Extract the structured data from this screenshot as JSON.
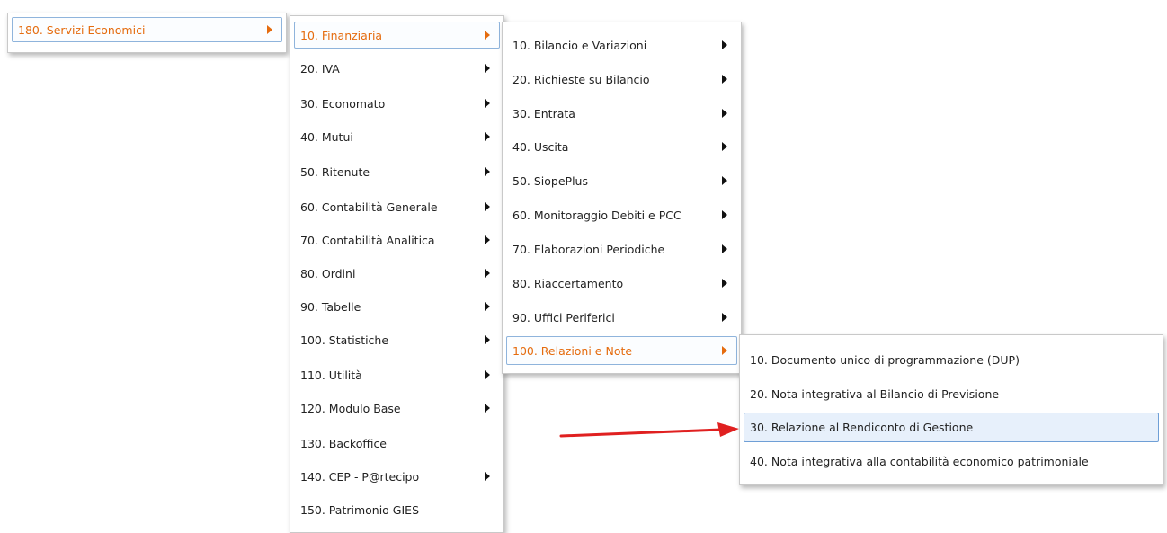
{
  "menu_level1": {
    "items": [
      {
        "label": "180. Servizi Economici",
        "state": "active",
        "submenu": true
      }
    ]
  },
  "menu_level2": {
    "items": [
      {
        "label": "10. Finanziaria",
        "state": "active",
        "submenu": true
      },
      {
        "label": "20. IVA",
        "submenu": true
      },
      {
        "label": "30. Economato",
        "submenu": true
      },
      {
        "label": "40. Mutui",
        "submenu": true
      },
      {
        "label": "50. Ritenute",
        "submenu": true
      },
      {
        "label": "60. Contabilità Generale",
        "submenu": true
      },
      {
        "label": "70. Contabilità Analitica",
        "submenu": true
      },
      {
        "label": "80. Ordini",
        "submenu": true
      },
      {
        "label": "90. Tabelle",
        "submenu": true
      },
      {
        "label": "100. Statistiche",
        "submenu": true
      },
      {
        "label": "110. Utilità",
        "submenu": true
      },
      {
        "label": "120. Modulo Base",
        "submenu": true
      },
      {
        "label": "130. Backoffice",
        "submenu": false
      },
      {
        "label": "140. CEP - P@rtecipo",
        "submenu": true
      },
      {
        "label": "150. Patrimonio GIES",
        "submenu": false
      }
    ]
  },
  "menu_level3": {
    "items": [
      {
        "label": "10. Bilancio e Variazioni",
        "submenu": true
      },
      {
        "label": "20. Richieste su Bilancio",
        "submenu": true
      },
      {
        "label": "30. Entrata",
        "submenu": true
      },
      {
        "label": "40. Uscita",
        "submenu": true
      },
      {
        "label": "50. SiopePlus",
        "submenu": true
      },
      {
        "label": "60. Monitoraggio Debiti e PCC",
        "submenu": true
      },
      {
        "label": "70. Elaborazioni Periodiche",
        "submenu": true
      },
      {
        "label": "80. Riaccertamento",
        "submenu": true
      },
      {
        "label": "90. Uffici Periferici",
        "submenu": true
      },
      {
        "label": "100. Relazioni e Note",
        "state": "active",
        "submenu": true
      }
    ]
  },
  "menu_level4": {
    "items": [
      {
        "label": "10. Documento unico di programmazione (DUP)"
      },
      {
        "label": "20. Nota integrativa al Bilancio di Previsione"
      },
      {
        "label": "30. Relazione al Rendiconto di Gestione",
        "state": "selected"
      },
      {
        "label": "40. Nota integrativa alla contabilità economico patrimoniale"
      }
    ]
  },
  "colors": {
    "active_text": "#e56c0f",
    "selected_border": "#6f9fd6",
    "pointer_arrow": "#e02020"
  }
}
